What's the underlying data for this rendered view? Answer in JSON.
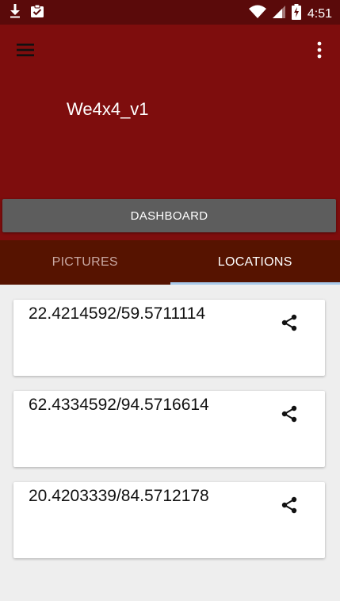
{
  "status_bar": {
    "time": "4:51",
    "icons": [
      "download-icon",
      "clipboard-check-icon",
      "wifi-icon",
      "signal-icon",
      "battery-charging-icon"
    ]
  },
  "app_bar": {
    "title": "We4x4_v1",
    "menu_icon": "hamburger-menu-icon",
    "overflow_icon": "more-vert-icon",
    "dashboard_label": "DASHBOARD"
  },
  "tabs": [
    {
      "label": "PICTURES",
      "active": false
    },
    {
      "label": "LOCATIONS",
      "active": true
    }
  ],
  "locations": [
    {
      "coords": "22.4214592/59.5711114",
      "share_icon": "share-icon"
    },
    {
      "coords": "62.4334592/94.5716614",
      "share_icon": "share-icon"
    },
    {
      "coords": "20.4203339/84.5712178",
      "share_icon": "share-icon"
    }
  ],
  "colors": {
    "status_bar": "#5a0a0a",
    "app_bar": "#7e0d0d",
    "tab_bar": "#561300",
    "tab_indicator": "#a8c9ea",
    "dashboard_button": "#5d5d5d",
    "background": "#eeeeee"
  }
}
